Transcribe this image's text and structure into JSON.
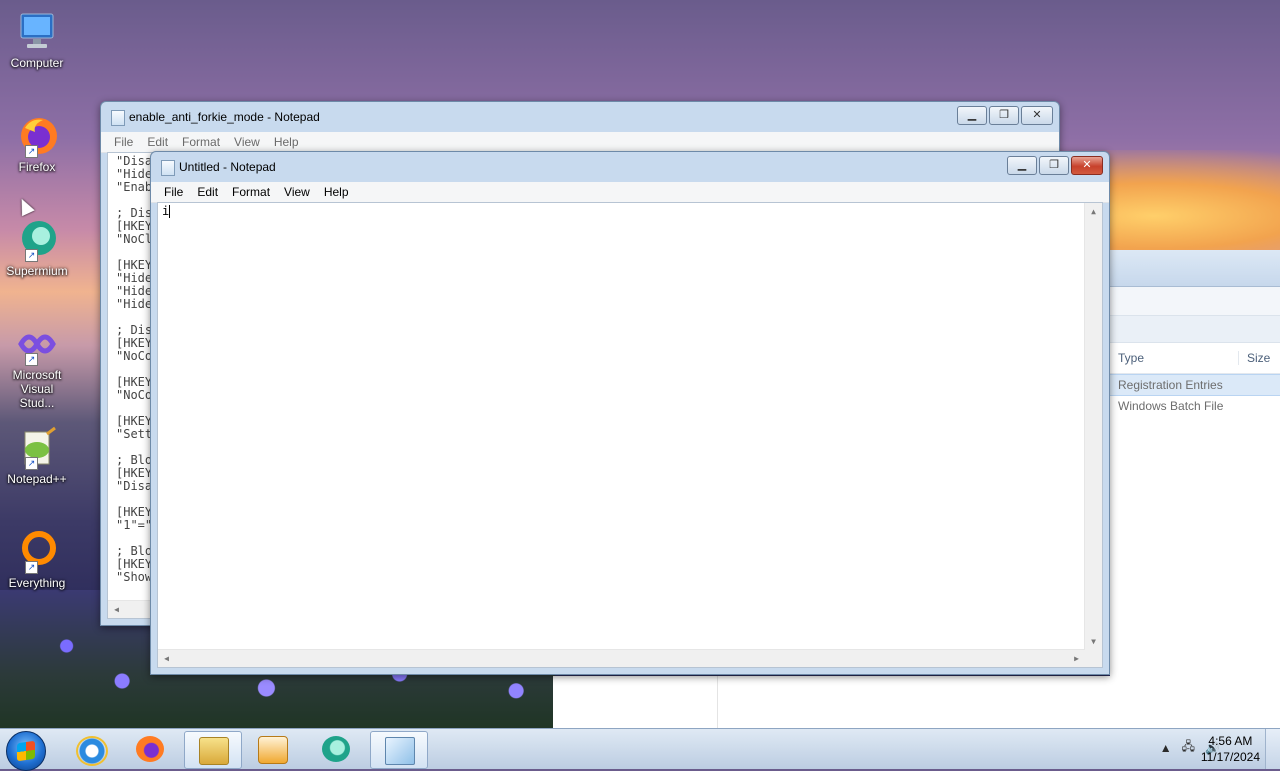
{
  "desktop": {
    "icons": [
      {
        "label": "Computer",
        "icon": "computer-icon"
      },
      {
        "label": "Firefox",
        "icon": "firefox-icon"
      },
      {
        "label": "Supermium",
        "icon": "supermium-icon"
      },
      {
        "label": "Microsoft Visual Stud...",
        "icon": "visual-studio-icon"
      },
      {
        "label": "Notepad++",
        "icon": "notepadpp-icon"
      },
      {
        "label": "Everything",
        "icon": "everything-icon"
      }
    ]
  },
  "explorer": {
    "columns": [
      "Type",
      "Size"
    ],
    "rows": [
      "Registration Entries",
      "Windows Batch File"
    ]
  },
  "back_window": {
    "title": "enable_anti_forkie_mode - Notepad",
    "menu": [
      "File",
      "Edit",
      "Format",
      "View",
      "Help"
    ],
    "lines": [
      "\"Disa",
      "\"Hide",
      "\"Enab",
      "",
      "; Dis",
      "[HKEY",
      "\"NoCl",
      "",
      "[HKEY",
      "\"Hide",
      "\"Hide",
      "\"Hide",
      "",
      "; Dis",
      "[HKEY",
      "\"NoCo",
      "",
      "[HKEY",
      "\"NoCo",
      "",
      "[HKEY",
      "\"Sett",
      "",
      "; Blo",
      "[HKEY",
      "\"Disa",
      "",
      "[HKEY",
      "\"1\"=\"",
      "",
      "; Blo",
      "[HKEY",
      "\"Show"
    ]
  },
  "front_window": {
    "title": "Untitled - Notepad",
    "menu": [
      "File",
      "Edit",
      "Format",
      "View",
      "Help"
    ],
    "content": "i"
  },
  "taskbar": {
    "apps": [
      "internet-explorer-icon",
      "firefox-icon",
      "file-explorer-icon",
      "media-player-icon",
      "supermium-icon",
      "notepad-icon"
    ],
    "time": "4:56 AM",
    "date": "11/17/2024"
  },
  "colors": {
    "titlebar_active": "#c8daee",
    "close_active": "#c7412c",
    "selection": "#dbe9f8"
  }
}
